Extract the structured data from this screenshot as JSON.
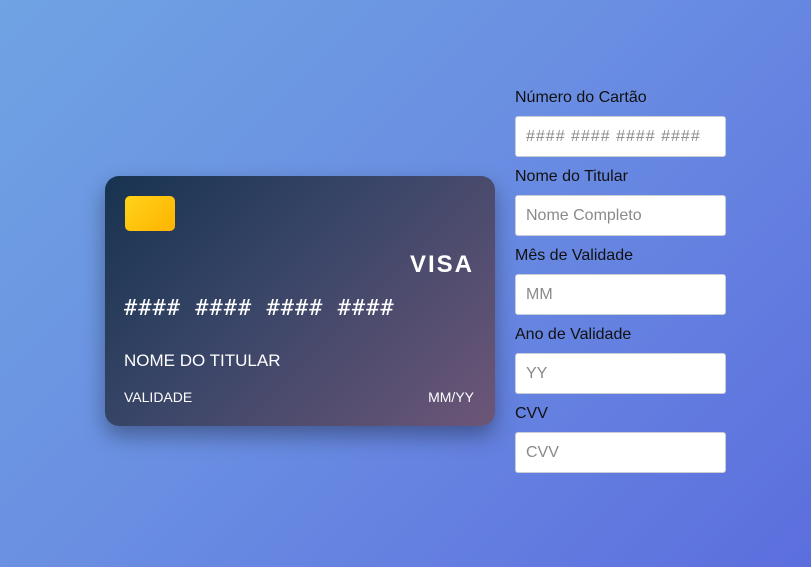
{
  "card": {
    "brand": "VISA",
    "number": "#### #### #### ####",
    "holder": "NOME DO TITULAR",
    "validity_label": "VALIDADE",
    "validity_value": "MM/YY",
    "chip_color": "#ffc400"
  },
  "form": {
    "card_number": {
      "label": "Número do Cartão",
      "placeholder": "#### #### #### ####",
      "value": ""
    },
    "holder_name": {
      "label": "Nome do Titular",
      "placeholder": "Nome Completo",
      "value": ""
    },
    "month": {
      "label": "Mês de Validade",
      "placeholder": "MM",
      "value": ""
    },
    "year": {
      "label": "Ano de Validade",
      "placeholder": "YY",
      "value": ""
    },
    "cvv": {
      "label": "CVV",
      "placeholder": "CVV",
      "value": ""
    }
  }
}
